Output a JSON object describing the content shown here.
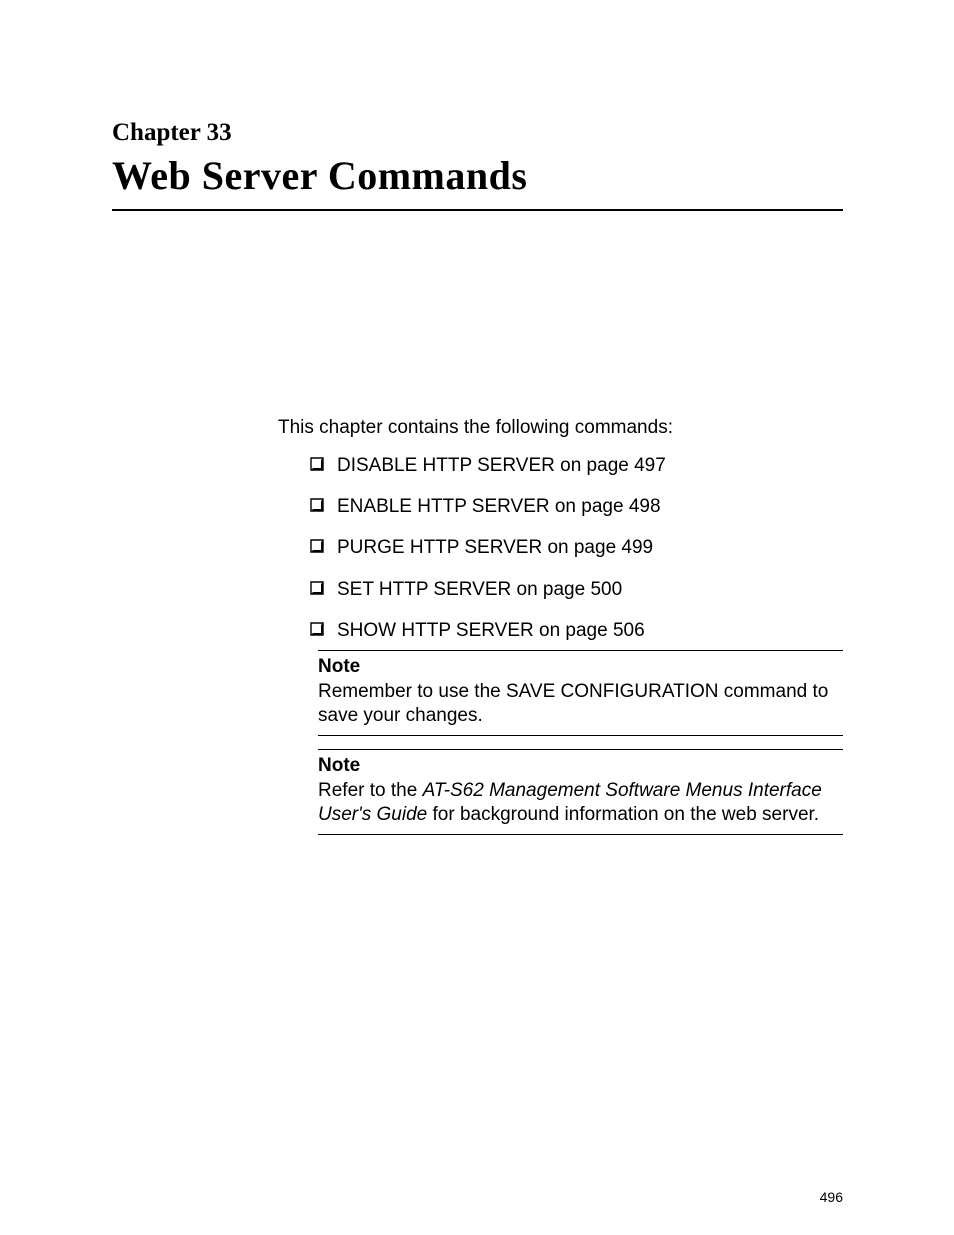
{
  "chapter": {
    "label": "Chapter 33",
    "title": "Web Server Commands"
  },
  "intro": "This chapter contains the following commands:",
  "commands": [
    {
      "text": "DISABLE HTTP SERVER on page 497"
    },
    {
      "text": "ENABLE HTTP SERVER on page 498"
    },
    {
      "text": "PURGE HTTP SERVER on page 499"
    },
    {
      "text": "SET HTTP SERVER on page 500"
    },
    {
      "text": "SHOW HTTP SERVER on page 506"
    }
  ],
  "notes": [
    {
      "heading": "Note",
      "body_plain": "Remember to use the SAVE CONFIGURATION command to save your changes."
    },
    {
      "heading": "Note",
      "body_prefix": "Refer to the ",
      "body_italic": "AT-S62 Management Software Menus Interface User's Guide",
      "body_suffix": " for background information on the web server."
    }
  ],
  "page_number": "496"
}
